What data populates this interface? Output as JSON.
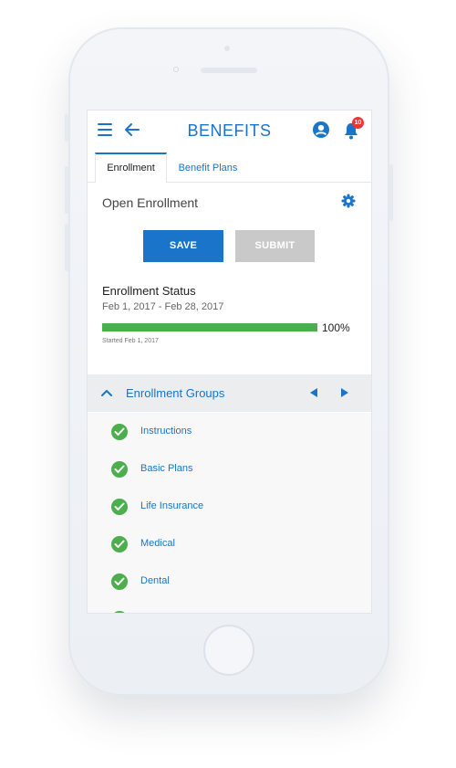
{
  "app": {
    "title": "BENEFITS",
    "notification_count": "10"
  },
  "tabs": [
    {
      "label": "Enrollment",
      "active": true
    },
    {
      "label": "Benefit Plans",
      "active": false
    }
  ],
  "section": {
    "title": "Open Enrollment"
  },
  "actions": {
    "save_label": "SAVE",
    "submit_label": "SUBMIT"
  },
  "status": {
    "title": "Enrollment Status",
    "dates": "Feb 1, 2017 - Feb 28, 2017",
    "progress": 1.0,
    "progress_label": "100%",
    "started": "Started Feb 1, 2017"
  },
  "groups": {
    "title": "Enrollment Groups",
    "items": [
      {
        "label": "Instructions",
        "complete": true
      },
      {
        "label": "Basic Plans",
        "complete": true
      },
      {
        "label": "Life Insurance",
        "complete": true
      },
      {
        "label": "Medical",
        "complete": true
      },
      {
        "label": "Dental",
        "complete": true
      }
    ]
  },
  "colors": {
    "accent": "#1a74c9",
    "success": "#4cae4c",
    "badge": "#e53935",
    "disabled": "#c9c9c9"
  },
  "icons": [
    "menu-icon",
    "back-arrow-icon",
    "user-icon",
    "bell-icon",
    "gear-icon",
    "chevron-up-icon",
    "previous-icon",
    "next-icon",
    "check-circle-icon"
  ]
}
